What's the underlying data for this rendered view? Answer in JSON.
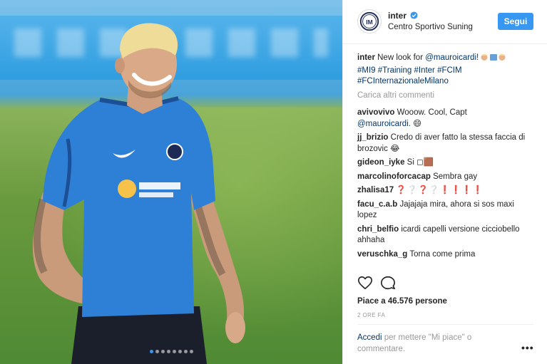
{
  "post": {
    "username": "inter",
    "location": "Centro Sportivo Suning",
    "follow_label": "Segui",
    "caption": {
      "username": "inter",
      "text": "New look for",
      "mention": "@mauroicardi!",
      "hashtags": "#MI9 #Training #Inter #FCIM #FCInternazionaleMilano"
    },
    "load_more": "Carica altri commenti",
    "comments": [
      {
        "user": "avivovivo",
        "text": "Wooow. Cool, Capt",
        "mention": "@mauroicardi.",
        "emoji": "😄"
      },
      {
        "user": "jj_brizio",
        "text": "Credo di aver fatto la stessa faccia di brozovic",
        "emoji": "😂"
      },
      {
        "user": "gideon_iyke",
        "text": "Si",
        "emoji": "◻🟫"
      },
      {
        "user": "marcolinoforcacap",
        "text": "Sembra gay"
      },
      {
        "user": "zhalisa17",
        "text": "❓❔❓❔❗❗❗❗"
      },
      {
        "user": "facu_c.a.b",
        "text": "Jajajaja mira, ahora si sos maxi lopez"
      },
      {
        "user": "chri_belfio",
        "text": "icardi capelli versione cicciobello ahhaha"
      },
      {
        "user": "veruschka_g",
        "text": "Torna come prima"
      }
    ],
    "likes": "Piace a 46.576 persone",
    "time": "2 ORE FA",
    "login_link": "Accedi",
    "login_text": "per mettere \"Mi piace\" o commentare.",
    "more_label": "•••",
    "icons": [
      "heart-icon",
      "comment-icon",
      "verified-icon",
      "more-options-icon"
    ],
    "colors": {
      "accent": "#3897f0",
      "link": "#003569",
      "muted": "#999999"
    },
    "carousel": {
      "slides": 8,
      "active_index": 0
    }
  }
}
